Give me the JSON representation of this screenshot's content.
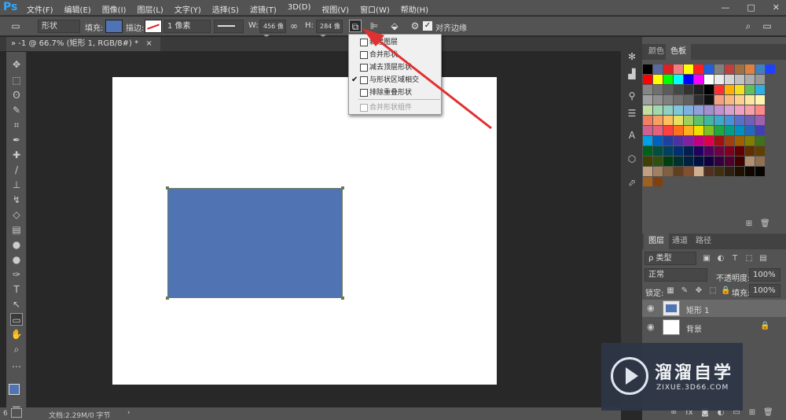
{
  "app": {
    "logo": "Ps"
  },
  "menu": [
    "文件(F)",
    "编辑(E)",
    "图像(I)",
    "图层(L)",
    "文字(Y)",
    "选择(S)",
    "滤镜(T)",
    "3D(D)",
    "视图(V)",
    "窗口(W)",
    "帮助(H)"
  ],
  "window_buttons": [
    "—",
    "□",
    "✕"
  ],
  "options": {
    "mode": "形状",
    "fill_label": "填充:",
    "stroke_label": "描边:",
    "stroke_width": "1 像素",
    "w_label": "W:",
    "w_value": "456 像素",
    "h_label": "H:",
    "h_value": "284 像素",
    "align_edges_label": "对齐边缘"
  },
  "document_tab": {
    "title": "-1 @ 66.7% (矩形 1, RGB/8#) *",
    "close": "×"
  },
  "status": {
    "zoom": "6",
    "doc_info": "文档:2.29M/0 字节"
  },
  "path_ops_menu": {
    "items": [
      {
        "label": "新建图层",
        "checked": false,
        "disabled": false
      },
      {
        "label": "合并形状",
        "checked": false,
        "disabled": false
      },
      {
        "label": "减去顶层形状",
        "checked": false,
        "disabled": false
      },
      {
        "label": "与形状区域相交",
        "checked": true,
        "disabled": false
      },
      {
        "label": "排除重叠形状",
        "checked": false,
        "disabled": false
      },
      {
        "label": "合并形状组件",
        "checked": false,
        "disabled": true
      }
    ]
  },
  "color_panel": {
    "tabs": [
      "颜色",
      "色板"
    ],
    "active_tab": 1
  },
  "swatches": [
    [
      "#000000",
      "#5a6aa0",
      "#e02020",
      "#f08080",
      "#ffff00",
      "#ff2020",
      "#2060e0",
      "#808080",
      "#c04040",
      "#a07040",
      "#e08040",
      "#4080c0",
      "#2040ff"
    ],
    [
      "#ff0000",
      "#ffff00",
      "#00ff00",
      "#00ffff",
      "#0000ff",
      "#ff00ff",
      "#ffffff",
      "#ebebeb",
      "#d6d6d6",
      "#c2c2c2",
      "#adadad",
      "#999999"
    ],
    [
      "#858585",
      "#707070",
      "#5c5c5c",
      "#474747",
      "#333333",
      "#1f1f1f",
      "#000000",
      "#ff3030",
      "#ffb000",
      "#f0e020",
      "#60c060",
      "#30b0e0"
    ],
    [
      "#a0a0a0",
      "#909090",
      "#808080",
      "#707070",
      "#606060",
      "#303030",
      "#101010",
      "#f4a080",
      "#f8b880",
      "#fcd090",
      "#fde6a0",
      "#fff4b0"
    ],
    [
      "#c0e0a0",
      "#a0d8b0",
      "#90d0c0",
      "#80c8d8",
      "#80b0e0",
      "#90a0d8",
      "#a090d0",
      "#c090d0",
      "#d8a0d0",
      "#f0a0c0",
      "#f8a0a8",
      "#ff8888"
    ],
    [
      "#f08060",
      "#f8a060",
      "#fcc060",
      "#e8e060",
      "#a0d060",
      "#60c070",
      "#40b8a0",
      "#40a8c8",
      "#4890d8",
      "#5870c8",
      "#7060b8",
      "#a060b0"
    ],
    [
      "#d06090",
      "#e86080",
      "#ff4040",
      "#ff7020",
      "#ffb020",
      "#f0e000",
      "#80c020",
      "#20a840",
      "#00a080",
      "#0090c0",
      "#2068c0",
      "#4040b0"
    ],
    [
      "#00a0e8",
      "#0060c0",
      "#2040a0",
      "#5030a0",
      "#8020a0",
      "#c00080",
      "#e0004c",
      "#a01010",
      "#a04010",
      "#a06000",
      "#808000",
      "#407020"
    ],
    [
      "#006020",
      "#005040",
      "#004060",
      "#003070",
      "#002050",
      "#200060",
      "#500060",
      "#700040",
      "#800020",
      "#600000",
      "#603000",
      "#604000"
    ],
    [
      "#404000",
      "#305010",
      "#004010",
      "#003030",
      "#002040",
      "#001040",
      "#100040",
      "#300040",
      "#500030",
      "#400000",
      "#b09070",
      "#907050"
    ],
    [
      "#c0a080",
      "#a08060",
      "#806040",
      "#604020",
      "#805030",
      "#d0b090",
      "#503020",
      "#403010",
      "#302010",
      "#201000",
      "#100800",
      "#080400"
    ],
    [
      "#a06020",
      "#804010"
    ]
  ],
  "layers_panel": {
    "tabs": [
      "图层",
      "通道",
      "路径"
    ],
    "filter_label": "ρ 类型",
    "blend_mode": "正常",
    "opacity_label": "不透明度:",
    "opacity_value": "100%",
    "lock_label": "锁定:",
    "fill_label": "填充:",
    "fill_value": "100%",
    "layers": [
      {
        "name": "矩形 1",
        "visible": true,
        "selected": true
      },
      {
        "name": "背景",
        "visible": true,
        "locked": true
      }
    ]
  },
  "watermark": {
    "title": "溜溜自学",
    "subtitle": "ZIXUE.3D66.COM"
  },
  "colors": {
    "shape_fill": "#4f73b3",
    "ui_dark": "#535353",
    "canvas_bg": "#282828",
    "arrow": "#e03030",
    "ps_blue": "#31a8ff"
  }
}
